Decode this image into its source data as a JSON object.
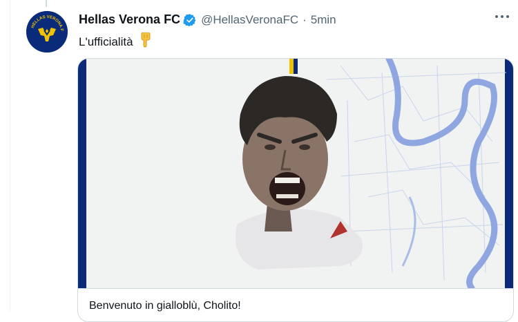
{
  "tweet": {
    "display_name": "Hellas Verona FC",
    "handle": "@HellasVeronaFC",
    "separator": "·",
    "time": "5min",
    "text": "L'ufficialità",
    "emoji_icon": "pointing-down-hand-icon",
    "more_icon": "more-options-icon",
    "verified_icon": "verified-badge-icon",
    "avatar_text": "HELLAS VERONA FC"
  },
  "card": {
    "caption": "Benvenuto in gialloblù, Cholito!"
  },
  "colors": {
    "verified_blue": "#1d9bf0",
    "club_blue": "#0a2b7a",
    "club_yellow": "#f2c200",
    "river_blue": "#8fa6e0"
  }
}
